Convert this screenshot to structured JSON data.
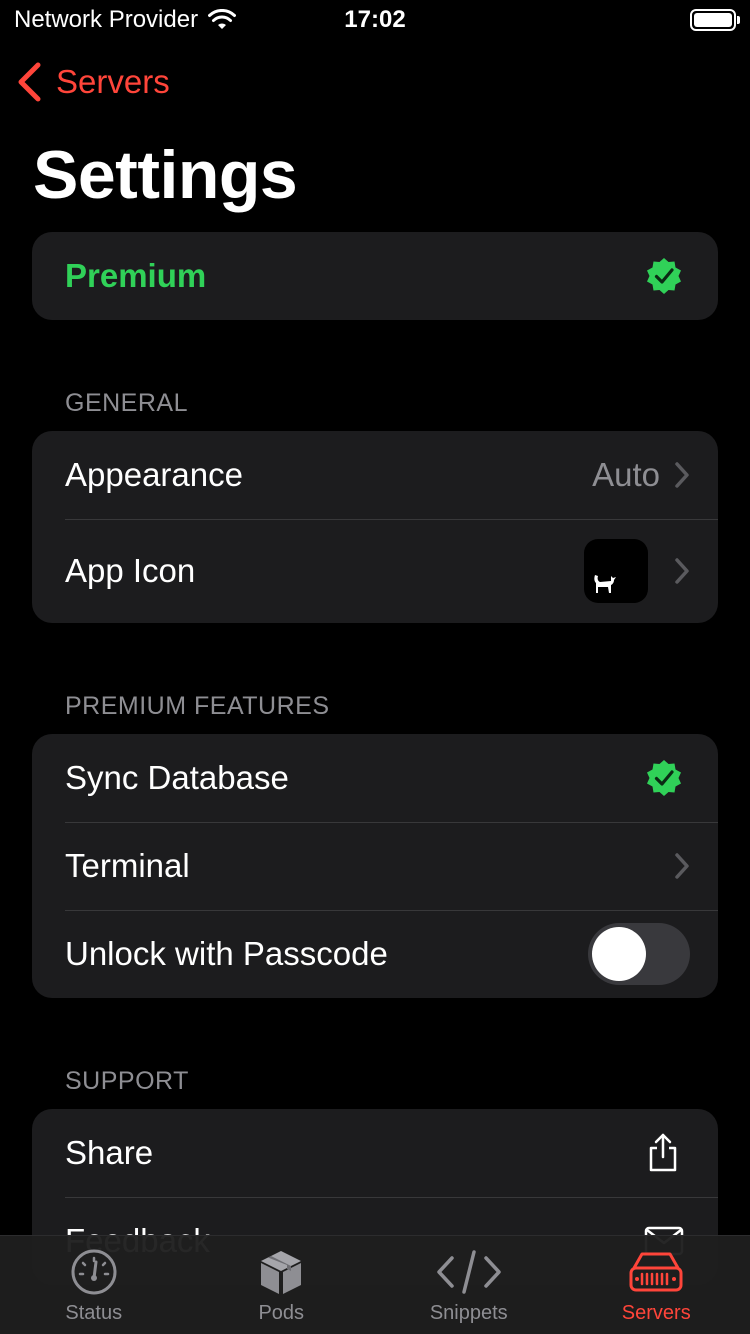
{
  "status_bar": {
    "carrier": "Network Provider",
    "time": "17:02"
  },
  "nav": {
    "back_label": "Servers",
    "title": "Settings"
  },
  "premium": {
    "label": "Premium"
  },
  "sections": {
    "general": {
      "header": "GENERAL",
      "appearance_label": "Appearance",
      "appearance_value": "Auto",
      "app_icon_label": "App Icon"
    },
    "premium_features": {
      "header": "PREMIUM FEATURES",
      "sync_label": "Sync Database",
      "terminal_label": "Terminal",
      "passcode_label": "Unlock with Passcode",
      "passcode_enabled": false
    },
    "support": {
      "header": "SUPPORT",
      "share_label": "Share",
      "feedback_label": "Feedback"
    }
  },
  "tabs": [
    {
      "label": "Status",
      "icon": "gauge-icon",
      "active": false
    },
    {
      "label": "Pods",
      "icon": "cube-icon",
      "active": false
    },
    {
      "label": "Snippets",
      "icon": "code-icon",
      "active": false
    },
    {
      "label": "Servers",
      "icon": "server-icon",
      "active": true
    }
  ],
  "colors": {
    "accent": "#ff453a",
    "success": "#30d158",
    "background": "#000000",
    "cell": "#1c1c1e"
  }
}
